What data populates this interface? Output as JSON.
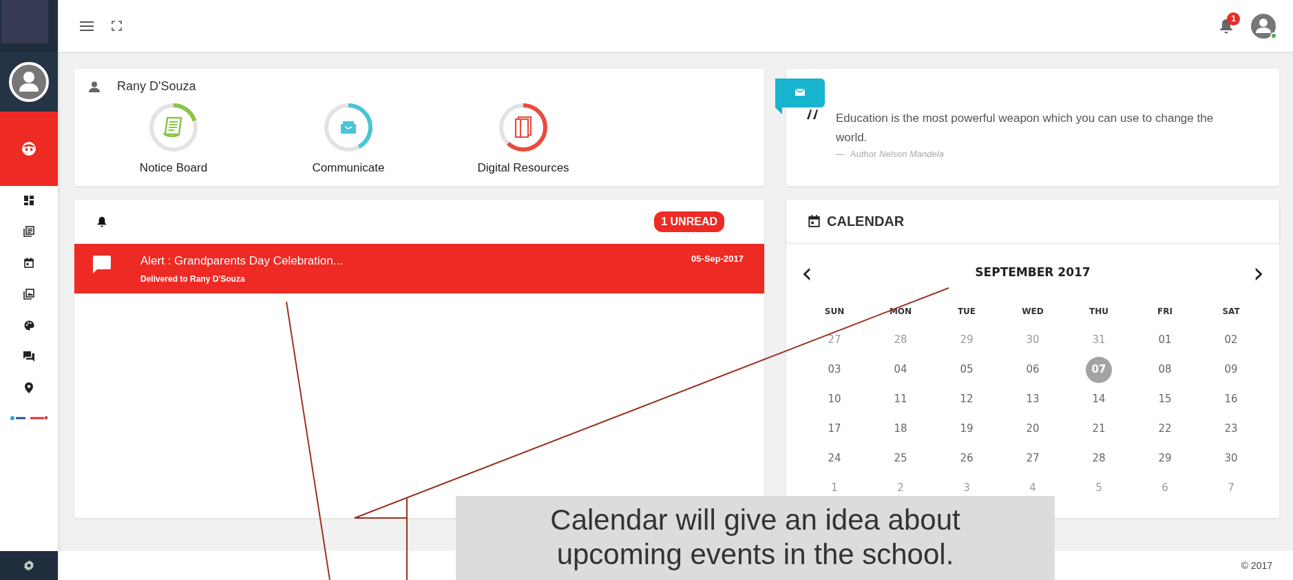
{
  "topbar": {
    "notifications": "1",
    "user_online": true
  },
  "profile_card": {
    "name": "Rany D'Souza",
    "modules": [
      {
        "label": "Notice Board",
        "kind": "notice",
        "level": 0.2,
        "color": "#8bc34a"
      },
      {
        "label": "Communicate",
        "kind": "communicate",
        "level": 0.42,
        "color": "#4cc3d6"
      },
      {
        "label": "Digital Resources",
        "kind": "resources",
        "level": 0.62,
        "color": "#e74c3c"
      }
    ]
  },
  "quote_card": {
    "quote": "Education is the most powerful weapon which you can use to change the world.",
    "dash": "—",
    "author_prefix": "Author",
    "author": "Nelson Mandela"
  },
  "notifications_card": {
    "badge": "1 UNREAD",
    "items": [
      {
        "title": "Alert : Grandparents Day Celebration...",
        "subtitle": "Delivered to Rany D'Souza",
        "date": "05-Sep-2017",
        "unread": true
      }
    ]
  },
  "calendar": {
    "title": "CALENDAR",
    "prev": "‹",
    "next": "›",
    "month": "SEPTEMBER 2017",
    "weekdays": [
      "SUN",
      "MON",
      "TUE",
      "WED",
      "THU",
      "FRI",
      "SAT"
    ],
    "weeks": [
      [
        {
          "day": "27",
          "outside": true,
          "selected": false
        },
        {
          "day": "28",
          "outside": true,
          "selected": false
        },
        {
          "day": "29",
          "outside": true,
          "selected": false
        },
        {
          "day": "30",
          "outside": true,
          "selected": false
        },
        {
          "day": "31",
          "outside": true,
          "selected": false
        },
        {
          "day": "01",
          "outside": false,
          "selected": false
        },
        {
          "day": "02",
          "outside": false,
          "selected": false
        }
      ],
      [
        {
          "day": "03",
          "outside": false,
          "selected": false
        },
        {
          "day": "04",
          "outside": false,
          "selected": false
        },
        {
          "day": "05",
          "outside": false,
          "selected": false
        },
        {
          "day": "06",
          "outside": false,
          "selected": false
        },
        {
          "day": "07",
          "outside": false,
          "selected": true
        },
        {
          "day": "08",
          "outside": false,
          "selected": false
        },
        {
          "day": "09",
          "outside": false,
          "selected": false
        }
      ],
      [
        {
          "day": "10",
          "outside": false,
          "selected": false
        },
        {
          "day": "11",
          "outside": false,
          "selected": false
        },
        {
          "day": "12",
          "outside": false,
          "selected": false
        },
        {
          "day": "13",
          "outside": false,
          "selected": false
        },
        {
          "day": "14",
          "outside": false,
          "selected": false
        },
        {
          "day": "15",
          "outside": false,
          "selected": false
        },
        {
          "day": "16",
          "outside": false,
          "selected": false
        }
      ],
      [
        {
          "day": "17",
          "outside": false,
          "selected": false
        },
        {
          "day": "18",
          "outside": false,
          "selected": false
        },
        {
          "day": "19",
          "outside": false,
          "selected": false
        },
        {
          "day": "20",
          "outside": false,
          "selected": false
        },
        {
          "day": "21",
          "outside": false,
          "selected": false
        },
        {
          "day": "22",
          "outside": false,
          "selected": false
        },
        {
          "day": "23",
          "outside": false,
          "selected": false
        }
      ],
      [
        {
          "day": "24",
          "outside": false,
          "selected": false
        },
        {
          "day": "25",
          "outside": false,
          "selected": false
        },
        {
          "day": "26",
          "outside": false,
          "selected": false
        },
        {
          "day": "27",
          "outside": false,
          "selected": false
        },
        {
          "day": "28",
          "outside": false,
          "selected": false
        },
        {
          "day": "29",
          "outside": false,
          "selected": false
        },
        {
          "day": "30",
          "outside": false,
          "selected": false
        }
      ],
      [
        {
          "day": "1",
          "outside": true,
          "selected": false
        },
        {
          "day": "2",
          "outside": true,
          "selected": false
        },
        {
          "day": "3",
          "outside": true,
          "selected": false
        },
        {
          "day": "4",
          "outside": true,
          "selected": false
        },
        {
          "day": "5",
          "outside": true,
          "selected": false
        },
        {
          "day": "6",
          "outside": true,
          "selected": false
        },
        {
          "day": "7",
          "outside": true,
          "selected": false
        }
      ]
    ]
  },
  "footer": {
    "copyright": "© 2017"
  },
  "callout": {
    "text": "Calendar will give an idea about upcoming events in the school."
  }
}
